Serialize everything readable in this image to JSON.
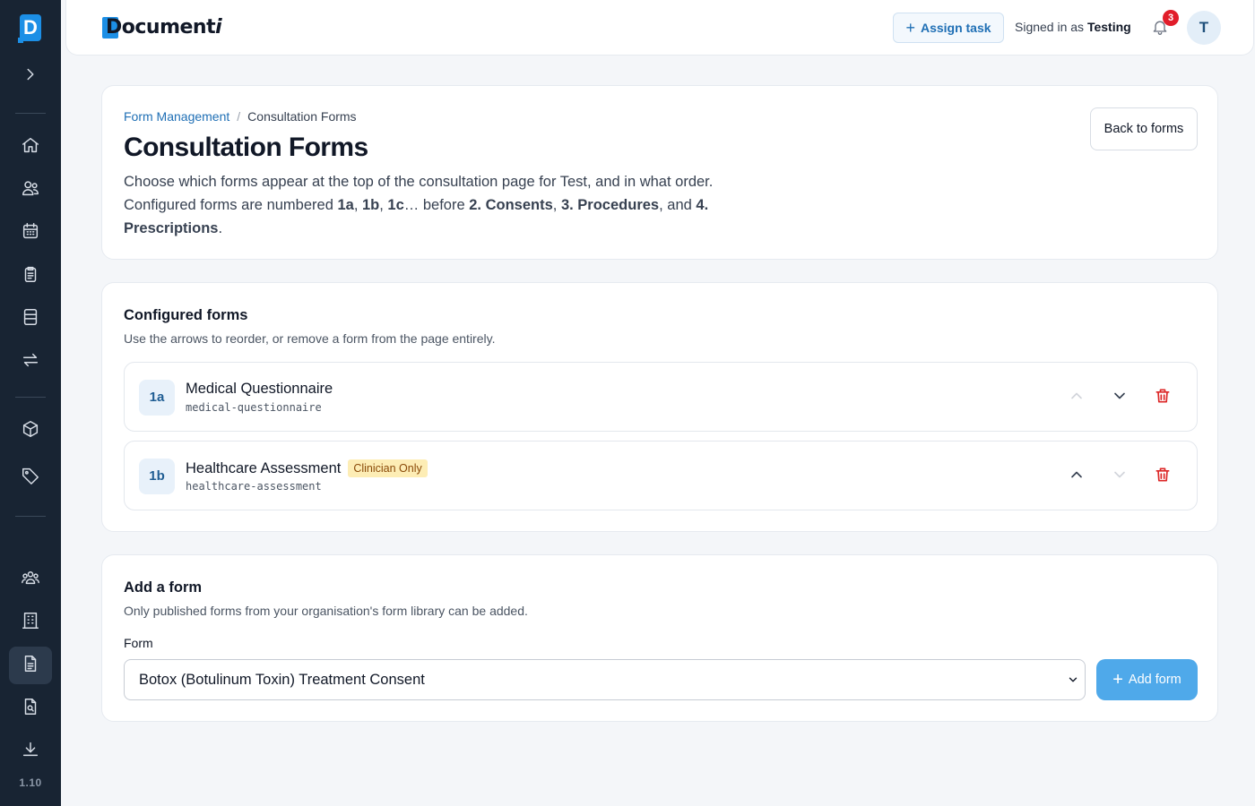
{
  "sidebar": {
    "logo_letter": "D",
    "version": "1.10",
    "items": [
      {
        "name": "expand",
        "icon": "chevron-right-icon"
      },
      {
        "name": "home",
        "icon": "home-icon"
      },
      {
        "name": "patients",
        "icon": "users-icon"
      },
      {
        "name": "calendar",
        "icon": "calendar-icon"
      },
      {
        "name": "clipboard",
        "icon": "clipboard-icon"
      },
      {
        "name": "forms",
        "icon": "layout-icon"
      },
      {
        "name": "transfer",
        "icon": "arrows-swap-icon"
      },
      {
        "name": "inventory",
        "icon": "box-icon"
      },
      {
        "name": "tags",
        "icon": "tag-icon"
      },
      {
        "name": "team",
        "icon": "team-icon"
      },
      {
        "name": "organisation",
        "icon": "building-icon"
      },
      {
        "name": "documents",
        "icon": "document-icon",
        "active": true
      },
      {
        "name": "document-search",
        "icon": "document-search-icon"
      },
      {
        "name": "download",
        "icon": "download-icon"
      }
    ]
  },
  "header": {
    "brand_main": "Document",
    "brand_italic": "i",
    "assign_task_label": "Assign task",
    "signed_in_prefix": "Signed in as",
    "signed_in_user": "Testing",
    "notification_count": "3",
    "avatar_initial": "T"
  },
  "page": {
    "breadcrumb": {
      "parent": "Form Management",
      "separator": "/",
      "current": "Consultation Forms"
    },
    "title": "Consultation Forms",
    "description": {
      "line1": "Choose which forms appear at the top of the consultation page for Test, and in what order.",
      "prefix": "Configured forms are numbered ",
      "n1": "1a",
      "c1": ", ",
      "n2": "1b",
      "c2": ", ",
      "n3": "1c",
      "mid": "… before ",
      "s1": "2. Consents",
      "c3": ", ",
      "s2": "3. Procedures",
      "c4": ", and ",
      "s3": "4. Prescriptions",
      "end": "."
    },
    "back_label": "Back to forms"
  },
  "configured": {
    "title": "Configured forms",
    "subtitle": "Use the arrows to reorder, or remove a form from the page entirely.",
    "forms": [
      {
        "number": "1a",
        "name": "Medical Questionnaire",
        "slug": "medical-questionnaire",
        "tag": "",
        "can_up": false,
        "can_down": true
      },
      {
        "number": "1b",
        "name": "Healthcare Assessment",
        "slug": "healthcare-assessment",
        "tag": "Clinician Only",
        "can_up": true,
        "can_down": false
      }
    ]
  },
  "add_form": {
    "title": "Add a form",
    "subtitle": "Only published forms from your organisation's form library can be added.",
    "field_label": "Form",
    "selected_value": "Botox (Botulinum Toxin) Treatment Consent",
    "button_label": "Add form"
  },
  "colors": {
    "sidebar_bg": "#182433",
    "accent": "#1c8fe6",
    "link": "#1f6fb5",
    "danger": "#dc2626",
    "tag_bg": "#fdedb5",
    "add_button_bg": "#4fa9ea"
  }
}
